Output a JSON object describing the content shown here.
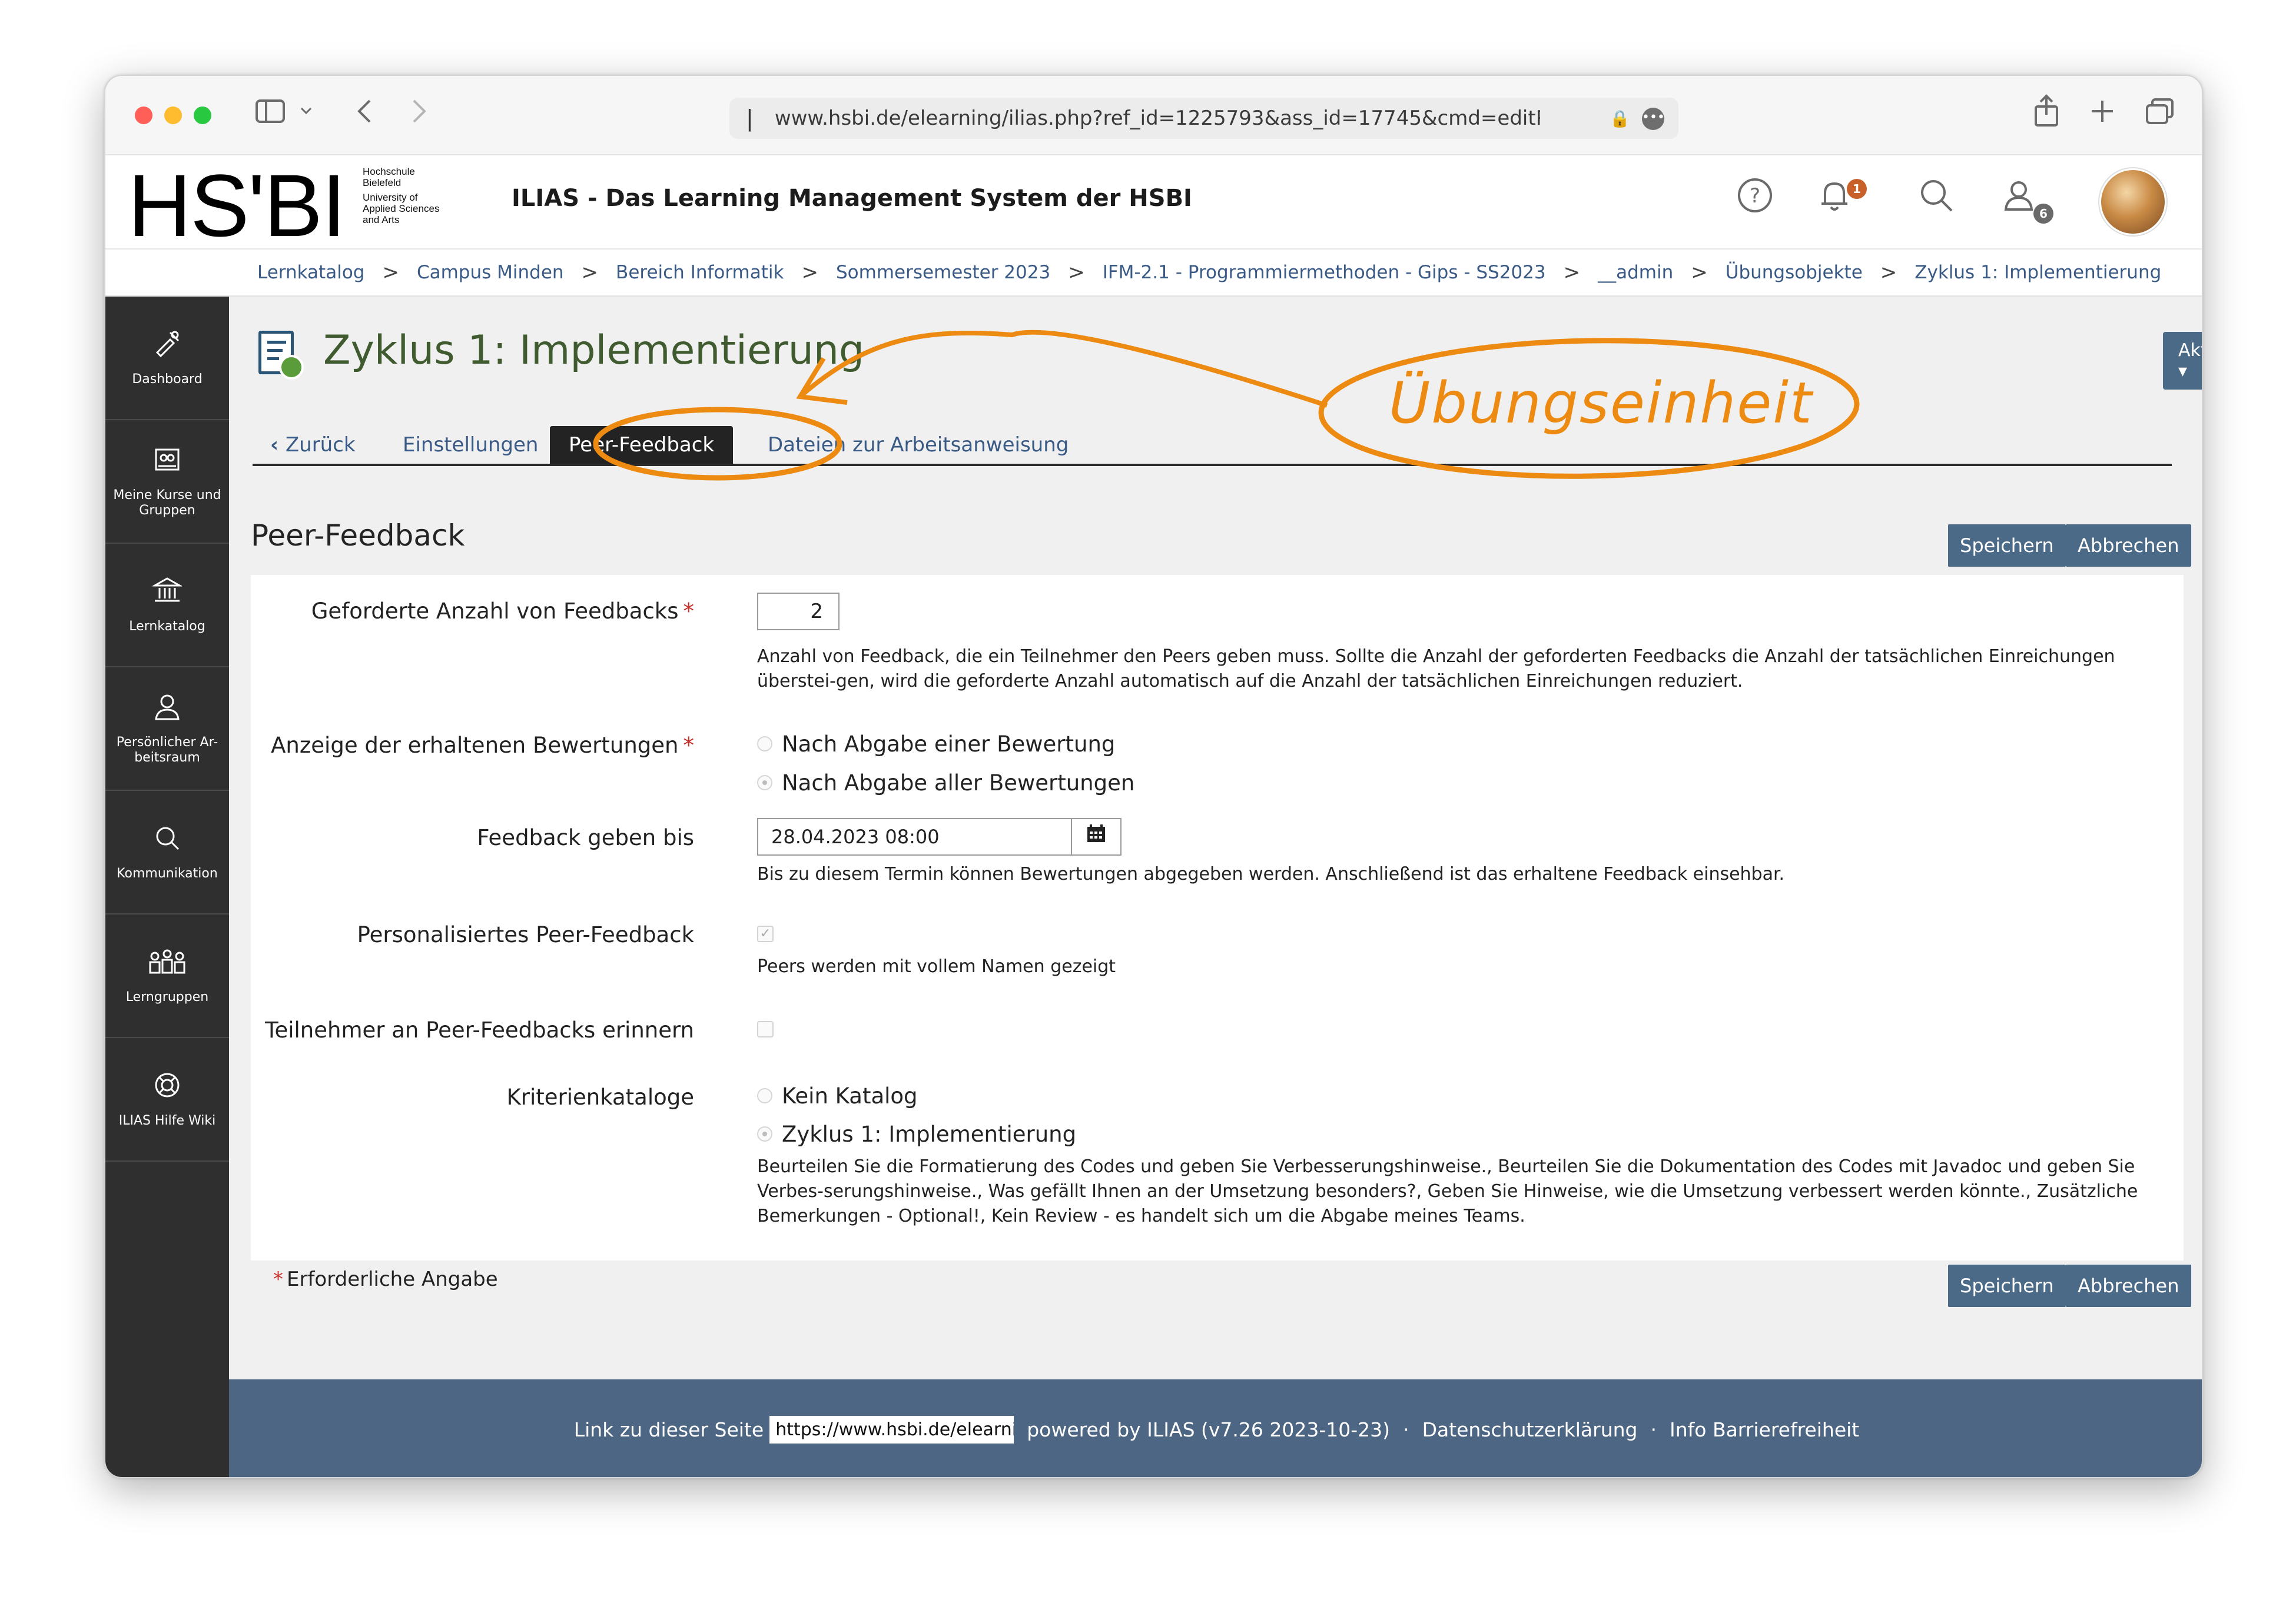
{
  "browser": {
    "url": "www.hsbi.de/elearning/ilias.php?ref_id=1225793&ass_id=17745&cmd=editPe",
    "icons": [
      "sidebar-icon",
      "chevron-down-icon",
      "back-icon",
      "forward-icon",
      "share-icon",
      "plus-icon",
      "tabs-icon"
    ]
  },
  "header": {
    "logo_text": "HS'BI",
    "logo_sub": [
      "Hochschule",
      "Bielefeld",
      "University of",
      "Applied Sciences",
      "and Arts"
    ],
    "app_title": "ILIAS - Das Learning Management System der HSBI",
    "notification_count": "1",
    "online_users_count": "6"
  },
  "breadcrumb": {
    "items": [
      "Lernkatalog",
      "Campus Minden",
      "Bereich Informatik",
      "Sommersemester 2023",
      "IFM-2.1 - Programmiermethoden - Gips - SS2023",
      "__admin",
      "Übungsobjekte",
      "Zyklus 1: Implementierung"
    ]
  },
  "sidebar": {
    "items": [
      {
        "label": "Dashboard",
        "icon": "dashboard-icon"
      },
      {
        "label": "Meine Kurse und Gruppen",
        "icon": "courses-icon"
      },
      {
        "label": "Lernkatalog",
        "icon": "catalog-icon"
      },
      {
        "label": "Persönlicher Ar-beitsraum",
        "icon": "person-icon"
      },
      {
        "label": "Kommunikation",
        "icon": "communication-icon"
      },
      {
        "label": "Lerngruppen",
        "icon": "groups-icon"
      },
      {
        "label": "ILIAS Hilfe Wiki",
        "icon": "help-lifebuoy-icon"
      }
    ]
  },
  "page": {
    "title": "Zyklus 1: Implementierung",
    "actions_label": "Aktionen ▾",
    "tabs": {
      "back": "Zurück",
      "settings": "Einstellungen",
      "peer_feedback": "Peer-Feedback",
      "files": "Dateien zur Arbeitsanweisung"
    },
    "annotation": "Übungseinheit"
  },
  "form": {
    "title": "Peer-Feedback",
    "save_label": "Speichern",
    "cancel_label": "Abbrechen",
    "required_feedbacks": {
      "label": "Geforderte Anzahl von Feedbacks",
      "value": "2",
      "help": "Anzahl von Feedback, die ein Teilnehmer den Peers geben muss. Sollte die Anzahl der geforderten Feedbacks die Anzahl der tatsächlichen Einreichungen überstei-gen, wird die geforderte Anzahl automatisch auf die Anzahl der tatsächlichen Einreichungen reduziert."
    },
    "display_ratings": {
      "label": "Anzeige der erhaltenen Bewertungen",
      "options": [
        "Nach Abgabe einer Bewertung",
        "Nach Abgabe aller Bewertungen"
      ],
      "selected": "Nach Abgabe aller Bewertungen"
    },
    "deadline": {
      "label": "Feedback geben bis",
      "value": "28.04.2023 08:00",
      "help": "Bis zu diesem Termin können Bewertungen abgegeben werden. Anschließend ist das erhaltene Feedback einsehbar."
    },
    "personalized": {
      "label": "Personalisiertes Peer-Feedback",
      "checked": true,
      "help": "Peers werden mit vollem Namen gezeigt"
    },
    "remind": {
      "label": "Teilnehmer an Peer-Feedbacks erinnern",
      "checked": false
    },
    "criteria": {
      "label": "Kriterienkataloge",
      "options": [
        "Kein Katalog",
        "Zyklus 1: Implementierung"
      ],
      "selected": "Zyklus 1: Implementierung",
      "help": "Beurteilen Sie die Formatierung des Codes und geben Sie Verbesserungshinweise., Beurteilen Sie die Dokumentation des Codes mit Javadoc und geben Sie Verbes-serungshinweise., Was gefällt Ihnen an der Umsetzung besonders?, Geben Sie Hinweise, wie die Umsetzung verbessert werden könnte., Zusätzliche Bemerkungen - Optional!, Kein Review - es handelt sich um die Abgabe meines Teams."
    },
    "required_note": "Erforderliche Angabe"
  },
  "footer": {
    "link_label": "Link zu dieser Seite",
    "link_value": "https://www.hsbi.de/elearning/",
    "powered_by": "powered by ILIAS (v7.26 2023-10-23)",
    "privacy": "Datenschutzerklärung",
    "accessibility": "Info Barrierefreiheit"
  },
  "colors": {
    "accent_button": "#4b6a88",
    "sidebar_bg": "#2f2f2f",
    "annotation": "#ec8a12",
    "footer_bg": "#4d6683",
    "title_green": "#3f5b2f"
  }
}
